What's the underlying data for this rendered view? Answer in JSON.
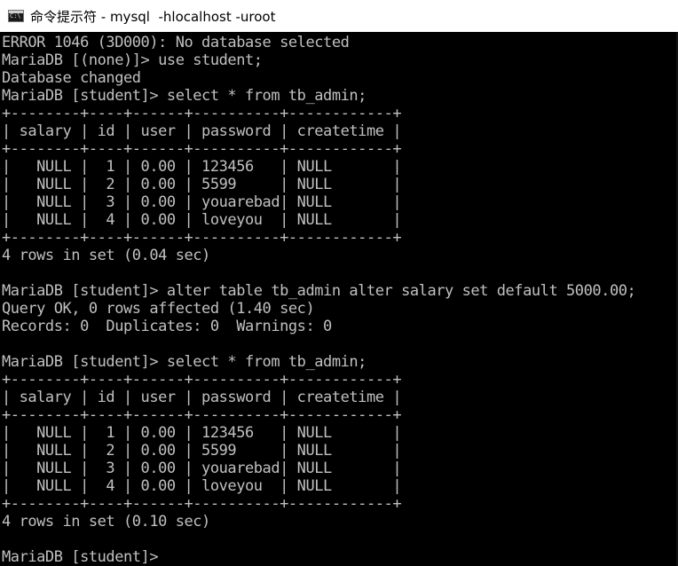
{
  "window": {
    "title": "命令提示符 - mysql  -hlocalhost -uroot"
  },
  "console": {
    "lines": [
      "ERROR 1046 (3D000): No database selected",
      "MariaDB [(none)]> use student;",
      "Database changed",
      "MariaDB [student]> select * from tb_admin;",
      "+--------+----+------+----------+------------+",
      "| salary | id | user | password | createtime |",
      "+--------+----+------+----------+------------+",
      "|   NULL |  1 | 0.00 | 123456   | NULL       |",
      "|   NULL |  2 | 0.00 | 5599     | NULL       |",
      "|   NULL |  3 | 0.00 | youarebad| NULL       |",
      "|   NULL |  4 | 0.00 | loveyou  | NULL       |",
      "+--------+----+------+----------+------------+",
      "4 rows in set (0.04 sec)",
      "",
      "MariaDB [student]> alter table tb_admin alter salary set default 5000.00;",
      "Query OK, 0 rows affected (1.40 sec)",
      "Records: 0  Duplicates: 0  Warnings: 0",
      "",
      "MariaDB [student]> select * from tb_admin;",
      "+--------+----+------+----------+------------+",
      "| salary | id | user | password | createtime |",
      "+--------+----+------+----------+------------+",
      "|   NULL |  1 | 0.00 | 123456   | NULL       |",
      "|   NULL |  2 | 0.00 | 5599     | NULL       |",
      "|   NULL |  3 | 0.00 | youarebad| NULL       |",
      "|   NULL |  4 | 0.00 | loveyou  | NULL       |",
      "+--------+----+------+----------+------------+",
      "4 rows in set (0.10 sec)",
      "",
      "MariaDB [student]>"
    ]
  },
  "colors": {
    "background": "#000000",
    "text": "#c0c0c0",
    "titlebar": "#ffffff"
  }
}
